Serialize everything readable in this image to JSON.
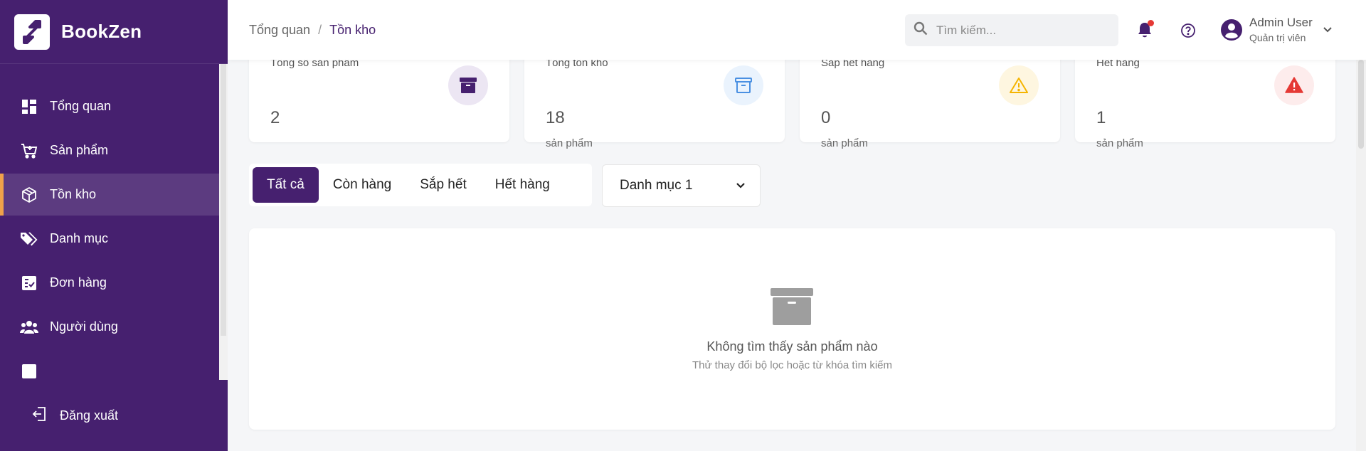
{
  "brand": {
    "name": "BookZen"
  },
  "sidebar": {
    "items": [
      {
        "label": "Tổng quan",
        "icon": "dashboard-icon"
      },
      {
        "label": "Sản phẩm",
        "icon": "cart-icon"
      },
      {
        "label": "Tồn kho",
        "icon": "box-icon",
        "active": true
      },
      {
        "label": "Danh mục",
        "icon": "tags-icon"
      },
      {
        "label": "Đơn hàng",
        "icon": "checklist-icon"
      },
      {
        "label": "Người dùng",
        "icon": "users-icon"
      }
    ],
    "logout_label": "Đăng xuất"
  },
  "header": {
    "breadcrumb": [
      "Tổng quan",
      "Tồn kho"
    ],
    "breadcrumb_sep": "/",
    "search_placeholder": "Tìm kiếm...",
    "user": {
      "name": "Admin User",
      "role": "Quản trị viên"
    }
  },
  "stats": [
    {
      "title": "Tổng số sản phẩm",
      "value": "2",
      "unit": "",
      "icon": "archive-icon",
      "color": "#46206f"
    },
    {
      "title": "Tổng tồn kho",
      "value": "18",
      "unit": "sản phẩm",
      "icon": "archive-outline-icon",
      "color": "#4a90e2"
    },
    {
      "title": "Sắp hết hàng",
      "value": "0",
      "unit": "sản phẩm",
      "icon": "warning-icon",
      "color": "#f5b400"
    },
    {
      "title": "Hết hàng",
      "value": "1",
      "unit": "sản phẩm",
      "icon": "alert-triangle-icon",
      "color": "#e53935"
    }
  ],
  "filters": {
    "tabs": [
      "Tất cả",
      "Còn hàng",
      "Sắp hết",
      "Hết hàng"
    ],
    "active_tab": "Tất cả",
    "category_selected": "Danh mục 1"
  },
  "empty_state": {
    "title": "Không tìm thấy sản phẩm nào",
    "subtitle": "Thử thay đổi bộ lọc hoặc từ khóa tìm kiếm"
  },
  "colors": {
    "sidebar": "#46206f",
    "active_accent": "#f0a24a",
    "primary": "#46206f"
  }
}
